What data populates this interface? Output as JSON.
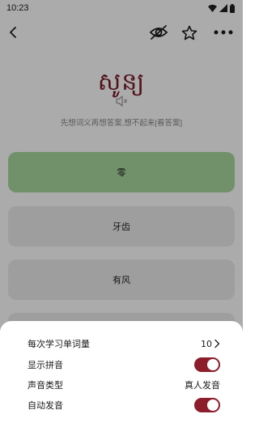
{
  "status_bar": {
    "time": "10:23",
    "icons": [
      "wifi-icon",
      "signal-icon",
      "battery-icon"
    ]
  },
  "toolbar": {
    "back_icon": "back-arrow-icon",
    "hide_icon": "eye-off-icon",
    "favorite_icon": "star-icon",
    "more_icon": "more-icon"
  },
  "word": {
    "text": "សូន្យ",
    "speaker_icon": "speaker-icon",
    "hint": "先想词义再想答案,想不起来[看答案]"
  },
  "options": [
    {
      "label": "零",
      "state": "correct"
    },
    {
      "label": "牙齿",
      "state": "normal"
    },
    {
      "label": "有风",
      "state": "normal"
    }
  ],
  "settings_sheet": {
    "words_per_session": {
      "label": "每次学习单词量",
      "value": "10"
    },
    "show_pinyin": {
      "label": "显示拼音",
      "enabled": true
    },
    "voice_type": {
      "label": "声音类型",
      "value": "真人发音"
    },
    "auto_play": {
      "label": "自动发音",
      "enabled": true
    }
  },
  "colors": {
    "accent": "#8c1d2b",
    "word": "#7a1b2c",
    "correct": "#a9d99e",
    "option_bg": "#ececec"
  }
}
